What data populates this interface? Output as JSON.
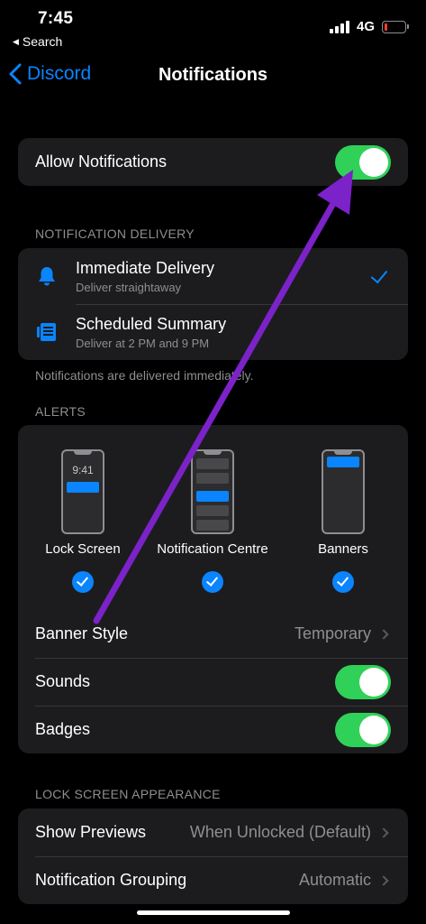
{
  "status_bar": {
    "time": "7:45",
    "back_app": "Search",
    "network": "4G"
  },
  "nav": {
    "back_label": "Discord",
    "title": "Notifications"
  },
  "allow": {
    "label": "Allow Notifications",
    "on": true
  },
  "delivery": {
    "header": "NOTIFICATION DELIVERY",
    "options": [
      {
        "title": "Immediate Delivery",
        "subtitle": "Deliver straightaway",
        "icon": "bell-icon",
        "selected": true
      },
      {
        "title": "Scheduled Summary",
        "subtitle": "Deliver at 2 PM and 9 PM",
        "icon": "summary-icon",
        "selected": false
      }
    ],
    "footer": "Notifications are delivered immediately."
  },
  "alerts": {
    "header": "ALERTS",
    "options": [
      {
        "label": "Lock Screen",
        "preview_time": "9:41",
        "checked": true
      },
      {
        "label": "Notification Centre",
        "checked": true
      },
      {
        "label": "Banners",
        "checked": true
      }
    ],
    "banner_style": {
      "label": "Banner Style",
      "value": "Temporary"
    },
    "sounds": {
      "label": "Sounds",
      "on": true
    },
    "badges": {
      "label": "Badges",
      "on": true
    }
  },
  "lock_screen": {
    "header": "LOCK SCREEN APPEARANCE",
    "show_previews": {
      "label": "Show Previews",
      "value": "When Unlocked (Default)"
    },
    "grouping": {
      "label": "Notification Grouping",
      "value": "Automatic"
    }
  },
  "colors": {
    "accent": "#0a84ff",
    "toggle_on": "#30d158",
    "annotation_arrow": "#7b22c9",
    "battery_low": "#ff3b30"
  }
}
